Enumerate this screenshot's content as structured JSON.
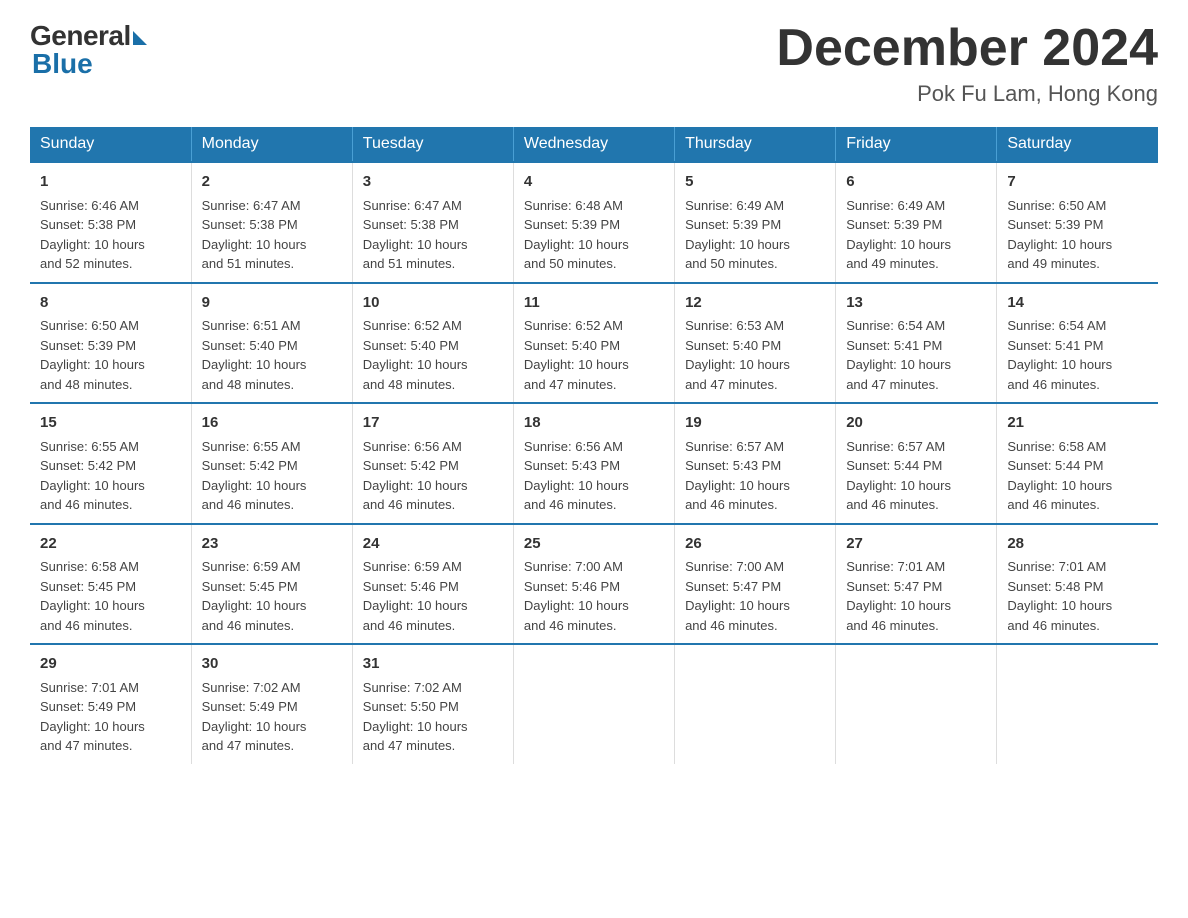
{
  "logo": {
    "general": "General",
    "blue": "Blue"
  },
  "title": "December 2024",
  "location": "Pok Fu Lam, Hong Kong",
  "headers": [
    "Sunday",
    "Monday",
    "Tuesday",
    "Wednesday",
    "Thursday",
    "Friday",
    "Saturday"
  ],
  "weeks": [
    [
      {
        "day": "1",
        "sunrise": "6:46 AM",
        "sunset": "5:38 PM",
        "daylight": "10 hours and 52 minutes."
      },
      {
        "day": "2",
        "sunrise": "6:47 AM",
        "sunset": "5:38 PM",
        "daylight": "10 hours and 51 minutes."
      },
      {
        "day": "3",
        "sunrise": "6:47 AM",
        "sunset": "5:38 PM",
        "daylight": "10 hours and 51 minutes."
      },
      {
        "day": "4",
        "sunrise": "6:48 AM",
        "sunset": "5:39 PM",
        "daylight": "10 hours and 50 minutes."
      },
      {
        "day": "5",
        "sunrise": "6:49 AM",
        "sunset": "5:39 PM",
        "daylight": "10 hours and 50 minutes."
      },
      {
        "day": "6",
        "sunrise": "6:49 AM",
        "sunset": "5:39 PM",
        "daylight": "10 hours and 49 minutes."
      },
      {
        "day": "7",
        "sunrise": "6:50 AM",
        "sunset": "5:39 PM",
        "daylight": "10 hours and 49 minutes."
      }
    ],
    [
      {
        "day": "8",
        "sunrise": "6:50 AM",
        "sunset": "5:39 PM",
        "daylight": "10 hours and 48 minutes."
      },
      {
        "day": "9",
        "sunrise": "6:51 AM",
        "sunset": "5:40 PM",
        "daylight": "10 hours and 48 minutes."
      },
      {
        "day": "10",
        "sunrise": "6:52 AM",
        "sunset": "5:40 PM",
        "daylight": "10 hours and 48 minutes."
      },
      {
        "day": "11",
        "sunrise": "6:52 AM",
        "sunset": "5:40 PM",
        "daylight": "10 hours and 47 minutes."
      },
      {
        "day": "12",
        "sunrise": "6:53 AM",
        "sunset": "5:40 PM",
        "daylight": "10 hours and 47 minutes."
      },
      {
        "day": "13",
        "sunrise": "6:54 AM",
        "sunset": "5:41 PM",
        "daylight": "10 hours and 47 minutes."
      },
      {
        "day": "14",
        "sunrise": "6:54 AM",
        "sunset": "5:41 PM",
        "daylight": "10 hours and 46 minutes."
      }
    ],
    [
      {
        "day": "15",
        "sunrise": "6:55 AM",
        "sunset": "5:42 PM",
        "daylight": "10 hours and 46 minutes."
      },
      {
        "day": "16",
        "sunrise": "6:55 AM",
        "sunset": "5:42 PM",
        "daylight": "10 hours and 46 minutes."
      },
      {
        "day": "17",
        "sunrise": "6:56 AM",
        "sunset": "5:42 PM",
        "daylight": "10 hours and 46 minutes."
      },
      {
        "day": "18",
        "sunrise": "6:56 AM",
        "sunset": "5:43 PM",
        "daylight": "10 hours and 46 minutes."
      },
      {
        "day": "19",
        "sunrise": "6:57 AM",
        "sunset": "5:43 PM",
        "daylight": "10 hours and 46 minutes."
      },
      {
        "day": "20",
        "sunrise": "6:57 AM",
        "sunset": "5:44 PM",
        "daylight": "10 hours and 46 minutes."
      },
      {
        "day": "21",
        "sunrise": "6:58 AM",
        "sunset": "5:44 PM",
        "daylight": "10 hours and 46 minutes."
      }
    ],
    [
      {
        "day": "22",
        "sunrise": "6:58 AM",
        "sunset": "5:45 PM",
        "daylight": "10 hours and 46 minutes."
      },
      {
        "day": "23",
        "sunrise": "6:59 AM",
        "sunset": "5:45 PM",
        "daylight": "10 hours and 46 minutes."
      },
      {
        "day": "24",
        "sunrise": "6:59 AM",
        "sunset": "5:46 PM",
        "daylight": "10 hours and 46 minutes."
      },
      {
        "day": "25",
        "sunrise": "7:00 AM",
        "sunset": "5:46 PM",
        "daylight": "10 hours and 46 minutes."
      },
      {
        "day": "26",
        "sunrise": "7:00 AM",
        "sunset": "5:47 PM",
        "daylight": "10 hours and 46 minutes."
      },
      {
        "day": "27",
        "sunrise": "7:01 AM",
        "sunset": "5:47 PM",
        "daylight": "10 hours and 46 minutes."
      },
      {
        "day": "28",
        "sunrise": "7:01 AM",
        "sunset": "5:48 PM",
        "daylight": "10 hours and 46 minutes."
      }
    ],
    [
      {
        "day": "29",
        "sunrise": "7:01 AM",
        "sunset": "5:49 PM",
        "daylight": "10 hours and 47 minutes."
      },
      {
        "day": "30",
        "sunrise": "7:02 AM",
        "sunset": "5:49 PM",
        "daylight": "10 hours and 47 minutes."
      },
      {
        "day": "31",
        "sunrise": "7:02 AM",
        "sunset": "5:50 PM",
        "daylight": "10 hours and 47 minutes."
      },
      {
        "day": "",
        "sunrise": "",
        "sunset": "",
        "daylight": ""
      },
      {
        "day": "",
        "sunrise": "",
        "sunset": "",
        "daylight": ""
      },
      {
        "day": "",
        "sunrise": "",
        "sunset": "",
        "daylight": ""
      },
      {
        "day": "",
        "sunrise": "",
        "sunset": "",
        "daylight": ""
      }
    ]
  ],
  "labels": {
    "sunrise": "Sunrise:",
    "sunset": "Sunset:",
    "daylight": "Daylight:"
  }
}
